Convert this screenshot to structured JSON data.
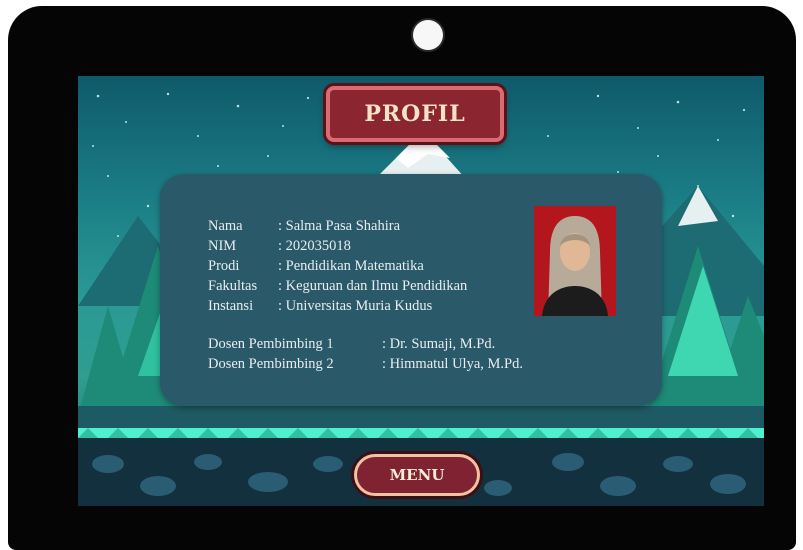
{
  "screen": {
    "title": "PROFIL",
    "menu_label": "MENU"
  },
  "profile": {
    "fields": [
      {
        "label": "Nama",
        "value": ": Salma Pasa Shahira"
      },
      {
        "label": "NIM",
        "value": ": 202035018"
      },
      {
        "label": "Prodi",
        "value": ": Pendidikan Matematika"
      },
      {
        "label": "Fakultas",
        "value": ": Keguruan dan Ilmu Pendidikan"
      },
      {
        "label": "Instansi",
        "value": ": Universitas Muria Kudus"
      }
    ],
    "supervisors": [
      {
        "label": "Dosen Pembimbing 1",
        "value": ": Dr. Sumaji, M.Pd."
      },
      {
        "label": "Dosen Pembimbing 2",
        "value": ": Himmatul Ulya, M.Pd."
      }
    ]
  },
  "colors": {
    "button_fill": "#8b2530",
    "button_border": "#d96b72",
    "panel": "#2a5a6a",
    "photo_background": "#b3161c"
  },
  "icons": {
    "camera": "camera-icon",
    "photo": "profile-photo"
  }
}
